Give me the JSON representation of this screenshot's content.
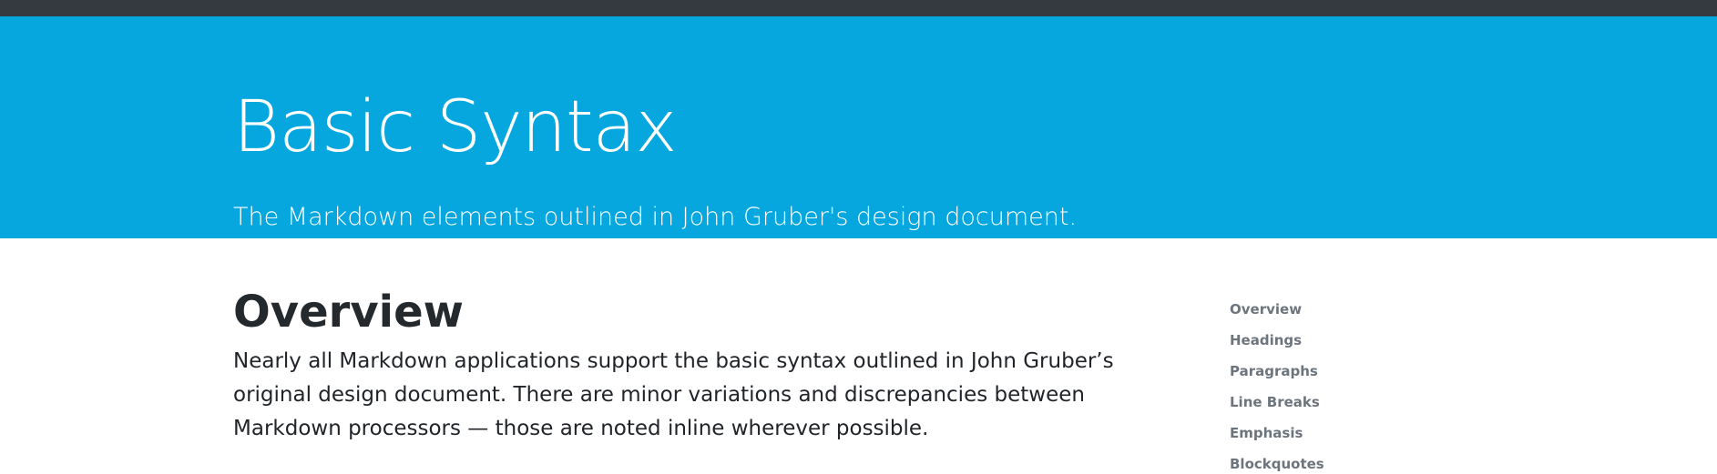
{
  "hero": {
    "title": "Basic Syntax",
    "subtitle": "The Markdown elements outlined in John Gruber's design document."
  },
  "overview": {
    "heading": "Overview",
    "body": "Nearly all Markdown applications support the basic syntax outlined in John Gruber’s original design document. There are minor variations and discrepancies between Markdown processors — those are noted inline wherever possible."
  },
  "toc": {
    "items": [
      {
        "label": "Overview"
      },
      {
        "label": "Headings"
      },
      {
        "label": "Paragraphs"
      },
      {
        "label": "Line Breaks"
      },
      {
        "label": "Emphasis"
      },
      {
        "label": "Blockquotes"
      }
    ]
  },
  "colors": {
    "topbar": "#343a40",
    "hero_background": "#05a7de",
    "hero_text": "#ffffff",
    "heading_text": "#24292e",
    "body_text": "#212529",
    "toc_link": "#6c757d"
  }
}
